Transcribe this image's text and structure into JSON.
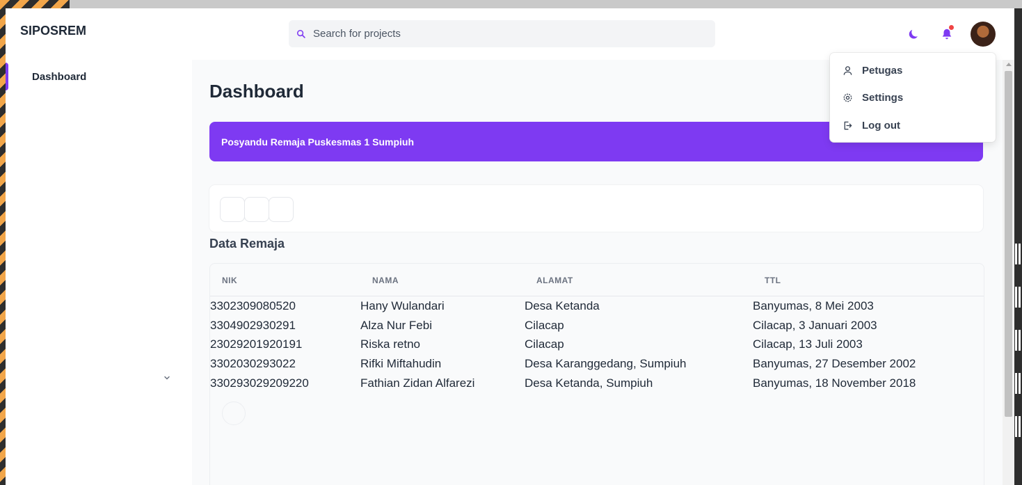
{
  "app": {
    "brand": "SIPOSREM"
  },
  "search": {
    "placeholder": "Search for projects"
  },
  "header_icons": [
    "moon-icon",
    "bell-icon",
    "avatar"
  ],
  "colors": {
    "accent": "#7e3af2",
    "notification_dot": "#ef4444"
  },
  "sidebar": {
    "items": [
      {
        "label": "Dashboard",
        "active": true
      }
    ]
  },
  "main": {
    "title": "Dashboard",
    "banner": "Posyandu Remaja Puskesmas 1 Sumpiuh",
    "section_title": "Data Remaja"
  },
  "table": {
    "headers": [
      "NIK",
      "NAMA",
      "ALAMAT",
      "TTL"
    ],
    "rows": [
      [
        "3302309080520",
        "Hany Wulandari",
        "Desa Ketanda",
        "Banyumas, 8 Mei 2003"
      ],
      [
        "3304902930291",
        "Alza Nur Febi",
        "Cilacap",
        "Cilacap, 3 Januari 2003"
      ],
      [
        "23029201920191",
        "Riska retno",
        "Cilacap",
        "Cilacap, 13 Juli 2003"
      ],
      [
        "3302030293022",
        "Rifki Miftahudin",
        "Desa Karanggedang, Sumpiuh",
        "Banyumas, 27 Desember 2002"
      ],
      [
        "330293029209220",
        "Fathian Zidan Alfarezi",
        "Desa Ketanda, Sumpiuh",
        "Banyumas, 18 November 2018"
      ]
    ]
  },
  "profile_menu": {
    "items": [
      {
        "label": "Petugas",
        "icon": "user-icon"
      },
      {
        "label": "Settings",
        "icon": "gear-icon"
      },
      {
        "label": "Log out",
        "icon": "logout-icon"
      }
    ]
  }
}
